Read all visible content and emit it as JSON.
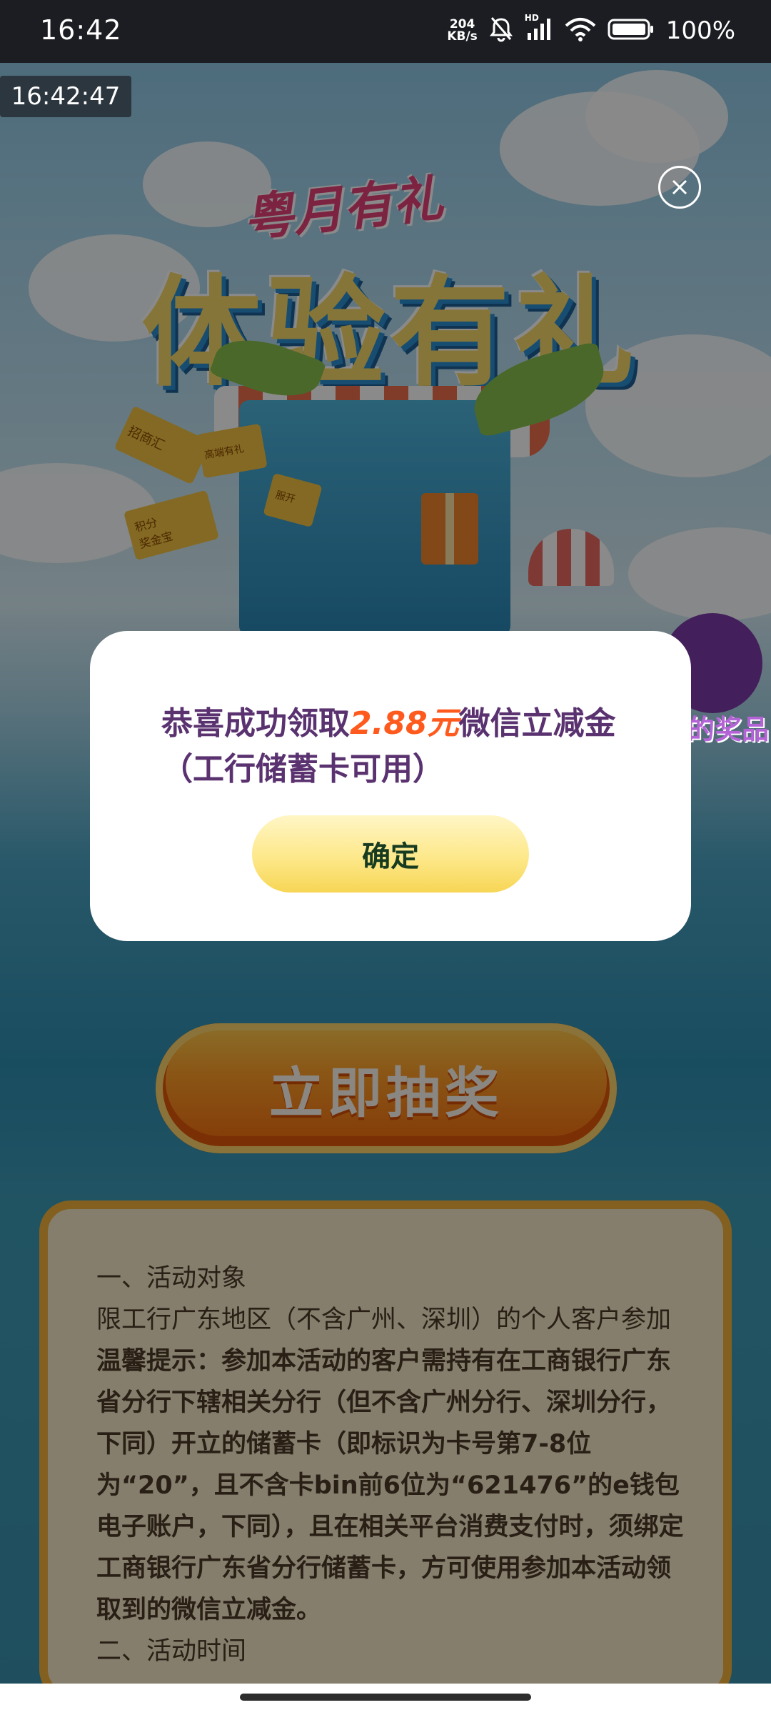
{
  "status_bar": {
    "time": "16:42",
    "net_speed_value": "204",
    "net_speed_unit": "KB/s",
    "hd_label": "HD",
    "battery_pct": "100%",
    "icons": [
      "mute-bell-icon",
      "signal-icon",
      "wifi-icon",
      "battery-icon"
    ]
  },
  "overlay": {
    "timer": "16:42:47",
    "close_icon": "close-circle-icon"
  },
  "banner": {
    "subtitle": "粤月有礼",
    "title": "体验有礼",
    "ticket_1": "招商汇",
    "ticket_2": "高端有礼",
    "ticket_3": "积分",
    "ticket_4": "服开",
    "ticket_5": "积分\n奖金宝",
    "prize_label": "的奖品"
  },
  "draw_button": {
    "label": "立即抽奖"
  },
  "rules": {
    "section1_heading": "一、活动对象",
    "section1_text": "限工行广东地区（不含广州、深圳）的个人客户参加",
    "tip": "温馨提示：参加本活动的客户需持有在工商银行广东省分行下辖相关分行（但不含广州分行、深圳分行，下同）开立的储蓄卡（即标识为卡号第7-8位为“20”，且不含卡bin前6位为“621476”的e钱包电子账户，下同），且在相关平台消费支付时，须绑定工商银行广东省分行储蓄卡，方可使用参加本活动领取到的微信立减金。",
    "section2_heading": "二、活动时间"
  },
  "modal": {
    "message_prefix": "恭喜成功领取",
    "amount": "2.88元",
    "message_suffix": "微信立减金（工行储蓄卡可用）",
    "confirm_label": "确定",
    "colors": {
      "text": "#5a3270",
      "amount": "#ff5a1e",
      "button": "#fde88a"
    }
  }
}
